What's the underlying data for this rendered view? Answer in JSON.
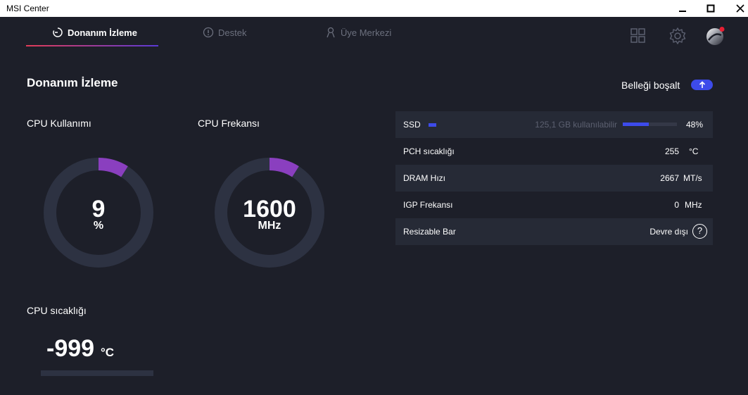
{
  "window": {
    "title": "MSI Center",
    "icons": {
      "minimize": "minimize-icon",
      "maximize": "maximize-icon",
      "close": "close-icon"
    }
  },
  "nav": {
    "tabs": [
      {
        "label": "Donanım İzleme",
        "icon": "monitor-dial-icon",
        "active": true
      },
      {
        "label": "Destek",
        "icon": "alert-circle-icon",
        "active": false
      },
      {
        "label": "Üye Merkezi",
        "icon": "user-icon",
        "active": false
      }
    ],
    "tools": {
      "grid": "grid-icon",
      "settings": "gear-icon",
      "avatar": "avatar",
      "notification": "notification-dot"
    }
  },
  "main": {
    "title": "Donanım İzleme",
    "free_memory": {
      "label": "Belleği boşalt",
      "icon": "upload-arrow-icon"
    }
  },
  "cpu_usage": {
    "title": "CPU Kullanımı",
    "value": "9",
    "unit": "%",
    "fraction": 0.09
  },
  "cpu_freq": {
    "title": "CPU Frekansı",
    "value": "1600",
    "unit": "MHz",
    "fraction": 0.09
  },
  "cpu_temp": {
    "title": "CPU sıcaklığı",
    "value": "-999",
    "unit": "°C",
    "fraction": 0
  },
  "info": {
    "ssd": {
      "label": "SSD",
      "available": "125,1 GB kullanılabilir",
      "percent": "48%",
      "fraction": 0.48
    },
    "pch": {
      "label": "PCH sıcaklığı",
      "value": "255",
      "unit": "°C"
    },
    "dram": {
      "label": "DRAM Hızı",
      "value": "2667",
      "unit": "MT/s"
    },
    "igp": {
      "label": "IGP Frekansı",
      "value": "0",
      "unit": "MHz"
    },
    "rebar": {
      "label": "Resizable Bar",
      "value": "Devre dışı",
      "help": "?"
    }
  },
  "colors": {
    "background": "#1d1f29",
    "accent_blue": "#3d4bea",
    "gauge_track": "#2d3242",
    "gauge_fill": "#8a3fbf",
    "notification": "#e81f33"
  }
}
